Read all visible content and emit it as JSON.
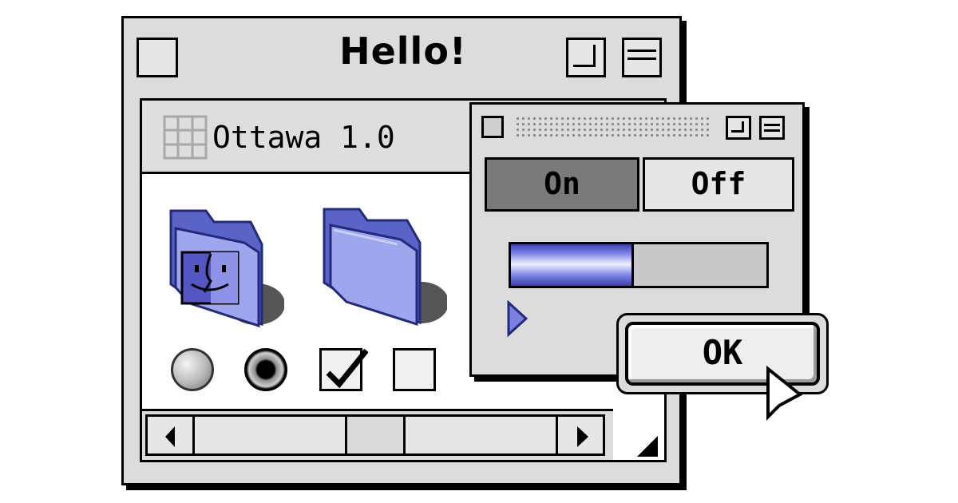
{
  "main_window": {
    "title": "Hello!",
    "app_title": "Ottawa 1.0",
    "controls": {
      "radio_unselected": false,
      "radio_selected": true,
      "checkbox_checked": true,
      "checkbox_unchecked": false
    }
  },
  "small_window": {
    "segmented": {
      "on_label": "On",
      "off_label": "Off",
      "selected": "On"
    },
    "progress": 0.48
  },
  "ok_button": {
    "label": "OK"
  },
  "icons": [
    "close-box-icon",
    "zoom-box-icon",
    "collapse-box-icon",
    "grid-icon",
    "finder-folder-icon",
    "folder-icon",
    "disclosure-triangle-icon",
    "scroll-left-arrow-icon",
    "scroll-right-arrow-icon",
    "resize-grip-icon",
    "pointer-cursor-icon"
  ],
  "colors": {
    "folder": "#9ea6ee",
    "folder_dark": "#5a63c6",
    "chrome": "#dcdcdc",
    "selected_segment": "#7a7a7a"
  }
}
